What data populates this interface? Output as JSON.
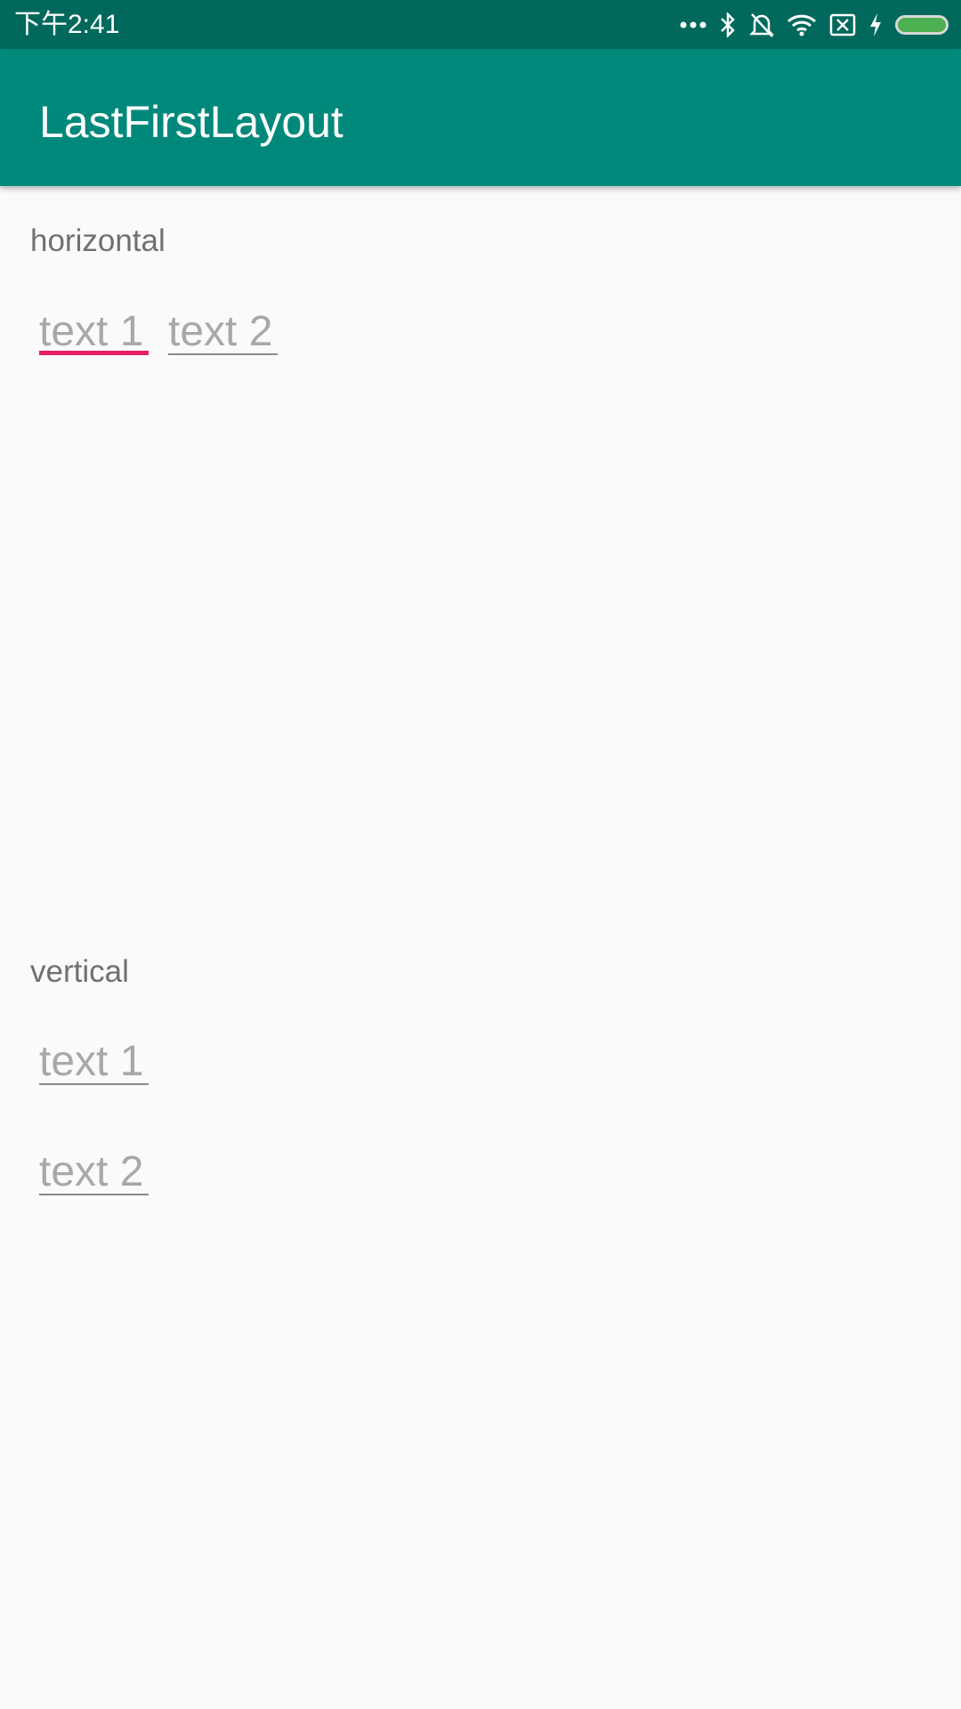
{
  "status_bar": {
    "time": "下午2:41",
    "icons": [
      "more-dots-icon",
      "bluetooth-icon",
      "alarm-off-icon",
      "wifi-icon",
      "no-sim-icon",
      "charging-icon",
      "battery-icon"
    ],
    "colors": {
      "background": "#00695c",
      "battery_fill": "#4caf50"
    }
  },
  "app_bar": {
    "title": "LastFirstLayout",
    "color": "#00897b"
  },
  "horizontal": {
    "label": "horizontal",
    "fields": [
      {
        "hint": "text 1",
        "focused": true
      },
      {
        "hint": "text 2",
        "focused": false
      }
    ]
  },
  "vertical": {
    "label": "vertical",
    "fields": [
      {
        "hint": "text 1",
        "focused": false
      },
      {
        "hint": "text 2",
        "focused": false
      }
    ]
  },
  "colors": {
    "accent": "#e91e63",
    "background": "#fafafa"
  }
}
